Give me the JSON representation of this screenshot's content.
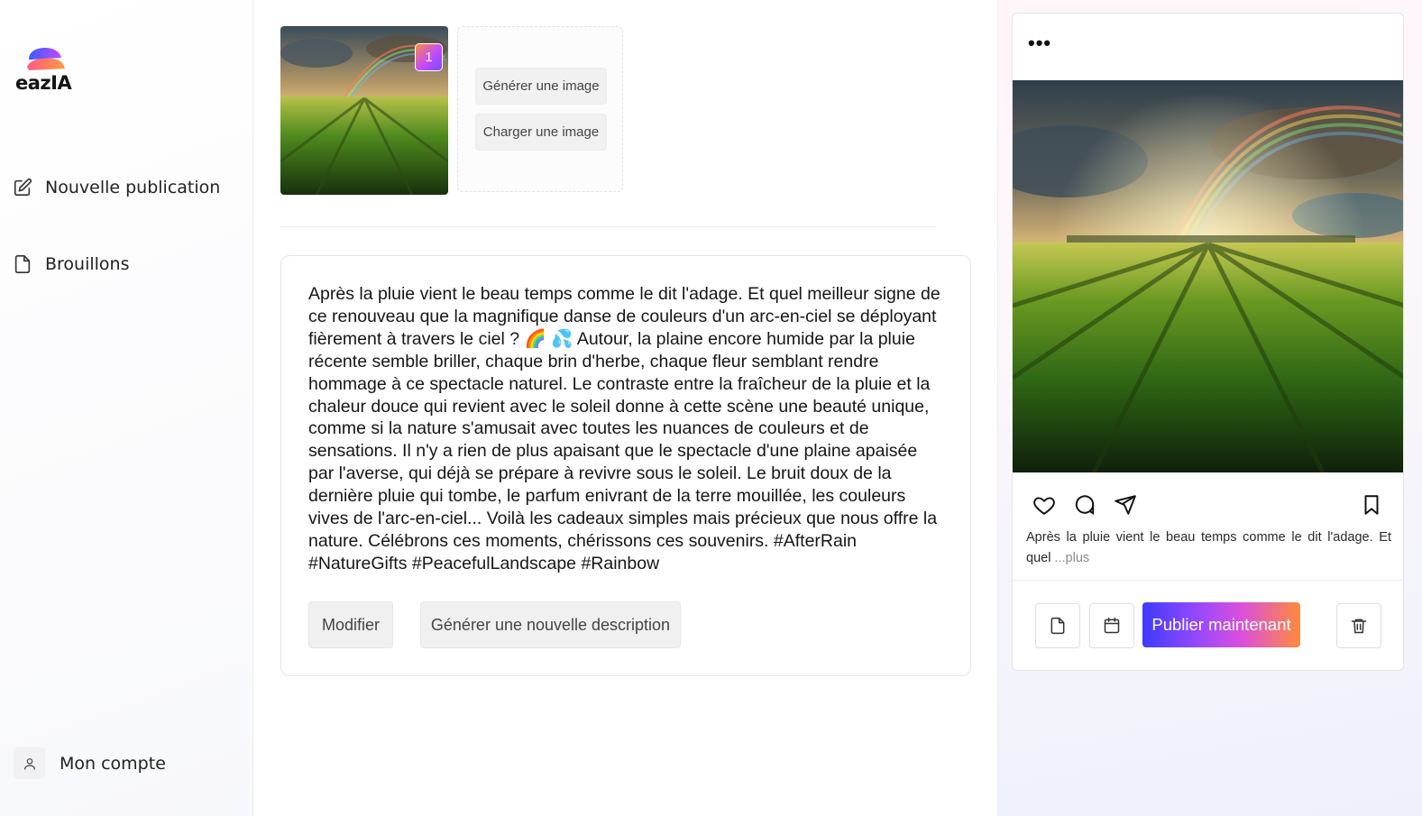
{
  "brand": {
    "name": "eazIA"
  },
  "sidebar": {
    "items": [
      {
        "label": "Nouvelle publication",
        "icon": "edit-icon"
      },
      {
        "label": "Brouillons",
        "icon": "file-icon"
      }
    ],
    "account_label": "Mon compte"
  },
  "media": {
    "image_index_badge": "1",
    "generate_image_label": "Générer une image",
    "upload_image_label": "Charger une image"
  },
  "description": {
    "text": "Après la pluie vient le beau temps comme le dit l'adage. Et quel meilleur signe de ce renouveau que la magnifique danse de couleurs d'un arc-en-ciel se déployant fièrement à travers le ciel ? 🌈 💦 Autour, la plaine encore humide par la pluie récente semble briller, chaque brin d'herbe, chaque fleur semblant rendre hommage à ce spectacle naturel. Le contraste entre la fraîcheur de la pluie et la chaleur douce qui revient avec le soleil donne à cette scène une beauté unique, comme si la nature s'amusait avec toutes les nuances de couleurs et de sensations. Il n'y a rien de plus apaisant que le spectacle d'une plaine apaisée par l'averse, qui déjà se prépare à revivre sous le soleil. Le bruit doux de la dernière pluie qui tombe, le parfum enivrant de la terre mouillée, les couleurs vives de l'arc-en-ciel... Voilà les cadeaux simples mais précieux que nous offre la nature. Célébrons ces moments, chérissons ces souvenirs. #AfterRain #NatureGifts #PeacefulLandscape #Rainbow",
    "modify_label": "Modifier",
    "regenerate_label": "Générer une nouvelle description"
  },
  "preview": {
    "menu_dots": "•••",
    "caption": "Après la pluie vient le beau temps comme le dit l'adage. Et quel",
    "more_label": "...plus",
    "publish_label": "Publier maintenant",
    "icons": [
      "heart-icon",
      "comment-icon",
      "share-icon",
      "bookmark-icon",
      "draft-file-icon",
      "calendar-icon",
      "trash-icon"
    ]
  },
  "colors": {
    "publish_gradient_start": "#3d3bff",
    "publish_gradient_end": "#ff8a3d",
    "badge_gradient": "#c24bff"
  }
}
